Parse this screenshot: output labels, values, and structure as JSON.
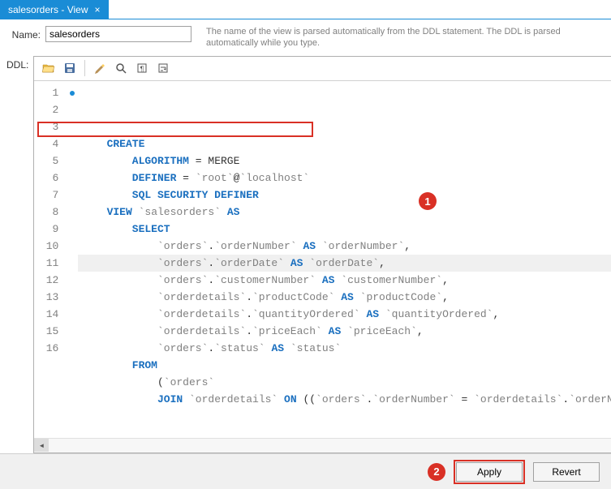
{
  "tab": {
    "title": "salesorders - View",
    "close": "×"
  },
  "form": {
    "name_label": "Name:",
    "name_value": "salesorders",
    "help_text": "The name of the view is parsed automatically from the DDL statement. The DDL is parsed automatically while you type.",
    "ddl_label": "DDL:"
  },
  "toolbar": {
    "open": "folder-open-icon",
    "save": "save-icon",
    "brush": "beautify-icon",
    "find": "search-icon",
    "invisibles": "pilcrow-icon",
    "wrap": "wrap-icon"
  },
  "code": {
    "lines": [
      {
        "n": 1,
        "marker": true,
        "indent": 1,
        "tokens": [
          {
            "t": "CREATE",
            "c": "kw"
          }
        ]
      },
      {
        "n": 2,
        "indent": 2,
        "tokens": [
          {
            "t": "ALGORITHM",
            "c": "kw"
          },
          {
            "t": " = MERGE",
            "c": "punct"
          }
        ]
      },
      {
        "n": 3,
        "indent": 2,
        "tokens": [
          {
            "t": "DEFINER",
            "c": "kw"
          },
          {
            "t": " = ",
            "c": "punct"
          },
          {
            "t": "`root`",
            "c": "str"
          },
          {
            "t": "@",
            "c": "punct"
          },
          {
            "t": "`localhost`",
            "c": "str"
          }
        ]
      },
      {
        "n": 4,
        "indent": 2,
        "tokens": [
          {
            "t": "SQL SECURITY DEFINER",
            "c": "kw"
          }
        ]
      },
      {
        "n": 5,
        "indent": 1,
        "tokens": [
          {
            "t": "VIEW",
            "c": "kw"
          },
          {
            "t": " ",
            "c": "punct"
          },
          {
            "t": "`salesorders`",
            "c": "str"
          },
          {
            "t": " ",
            "c": "punct"
          },
          {
            "t": "AS",
            "c": "kw"
          }
        ]
      },
      {
        "n": 6,
        "indent": 2,
        "tokens": [
          {
            "t": "SELECT",
            "c": "kw"
          }
        ]
      },
      {
        "n": 7,
        "indent": 3,
        "tokens": [
          {
            "t": "`orders`",
            "c": "str"
          },
          {
            "t": ".",
            "c": "punct"
          },
          {
            "t": "`orderNumber`",
            "c": "str"
          },
          {
            "t": " ",
            "c": "punct"
          },
          {
            "t": "AS",
            "c": "kw"
          },
          {
            "t": " ",
            "c": "punct"
          },
          {
            "t": "`orderNumber`",
            "c": "str"
          },
          {
            "t": ",",
            "c": "punct"
          }
        ]
      },
      {
        "n": 8,
        "indent": 3,
        "hl": true,
        "tokens": [
          {
            "t": "`orders`",
            "c": "str"
          },
          {
            "t": ".",
            "c": "punct"
          },
          {
            "t": "`orderDate`",
            "c": "str"
          },
          {
            "t": " ",
            "c": "punct"
          },
          {
            "t": "AS",
            "c": "kw"
          },
          {
            "t": " ",
            "c": "punct"
          },
          {
            "t": "`orderDate`",
            "c": "str"
          },
          {
            "t": ",",
            "c": "punct"
          }
        ]
      },
      {
        "n": 9,
        "indent": 3,
        "tokens": [
          {
            "t": "`orders`",
            "c": "str"
          },
          {
            "t": ".",
            "c": "punct"
          },
          {
            "t": "`customerNumber`",
            "c": "str"
          },
          {
            "t": " ",
            "c": "punct"
          },
          {
            "t": "AS",
            "c": "kw"
          },
          {
            "t": " ",
            "c": "punct"
          },
          {
            "t": "`customerNumber`",
            "c": "str"
          },
          {
            "t": ",",
            "c": "punct"
          }
        ]
      },
      {
        "n": 10,
        "indent": 3,
        "tokens": [
          {
            "t": "`orderdetails`",
            "c": "str"
          },
          {
            "t": ".",
            "c": "punct"
          },
          {
            "t": "`productCode`",
            "c": "str"
          },
          {
            "t": " ",
            "c": "punct"
          },
          {
            "t": "AS",
            "c": "kw"
          },
          {
            "t": " ",
            "c": "punct"
          },
          {
            "t": "`productCode`",
            "c": "str"
          },
          {
            "t": ",",
            "c": "punct"
          }
        ]
      },
      {
        "n": 11,
        "indent": 3,
        "tokens": [
          {
            "t": "`orderdetails`",
            "c": "str"
          },
          {
            "t": ".",
            "c": "punct"
          },
          {
            "t": "`quantityOrdered`",
            "c": "str"
          },
          {
            "t": " ",
            "c": "punct"
          },
          {
            "t": "AS",
            "c": "kw"
          },
          {
            "t": " ",
            "c": "punct"
          },
          {
            "t": "`quantityOrdered`",
            "c": "str"
          },
          {
            "t": ",",
            "c": "punct"
          }
        ]
      },
      {
        "n": 12,
        "indent": 3,
        "tokens": [
          {
            "t": "`orderdetails`",
            "c": "str"
          },
          {
            "t": ".",
            "c": "punct"
          },
          {
            "t": "`priceEach`",
            "c": "str"
          },
          {
            "t": " ",
            "c": "punct"
          },
          {
            "t": "AS",
            "c": "kw"
          },
          {
            "t": " ",
            "c": "punct"
          },
          {
            "t": "`priceEach`",
            "c": "str"
          },
          {
            "t": ",",
            "c": "punct"
          }
        ]
      },
      {
        "n": 13,
        "indent": 3,
        "tokens": [
          {
            "t": "`orders`",
            "c": "str"
          },
          {
            "t": ".",
            "c": "punct"
          },
          {
            "t": "`status`",
            "c": "str"
          },
          {
            "t": " ",
            "c": "punct"
          },
          {
            "t": "AS",
            "c": "kw"
          },
          {
            "t": " ",
            "c": "punct"
          },
          {
            "t": "`status`",
            "c": "str"
          }
        ]
      },
      {
        "n": 14,
        "indent": 2,
        "tokens": [
          {
            "t": "FROM",
            "c": "kw"
          }
        ]
      },
      {
        "n": 15,
        "indent": 3,
        "tokens": [
          {
            "t": "(",
            "c": "punct"
          },
          {
            "t": "`orders`",
            "c": "str"
          }
        ]
      },
      {
        "n": 16,
        "indent": 3,
        "tokens": [
          {
            "t": "JOIN",
            "c": "kw"
          },
          {
            "t": " ",
            "c": "punct"
          },
          {
            "t": "`orderdetails`",
            "c": "str"
          },
          {
            "t": " ",
            "c": "punct"
          },
          {
            "t": "ON",
            "c": "kw"
          },
          {
            "t": " ((",
            "c": "punct"
          },
          {
            "t": "`orders`",
            "c": "str"
          },
          {
            "t": ".",
            "c": "punct"
          },
          {
            "t": "`orderNumber`",
            "c": "str"
          },
          {
            "t": " = ",
            "c": "punct"
          },
          {
            "t": "`orderdetails`",
            "c": "str"
          },
          {
            "t": ".",
            "c": "punct"
          },
          {
            "t": "`orderNumber`",
            "c": "str"
          },
          {
            "t": ")))",
            "c": "punct"
          }
        ]
      }
    ]
  },
  "footer": {
    "apply": "Apply",
    "revert": "Revert"
  },
  "callouts": {
    "c1": "1",
    "c2": "2"
  }
}
